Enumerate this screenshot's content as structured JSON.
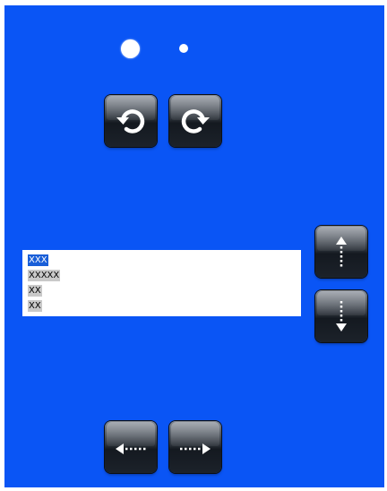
{
  "page_indicator": {
    "total": 2,
    "active_index": 0
  },
  "toolbar_top": {
    "rotate_left_icon": "rotate-counterclockwise-icon",
    "rotate_right_icon": "rotate-clockwise-icon"
  },
  "list": {
    "items": [
      {
        "label": "XXX",
        "selected": true
      },
      {
        "label": "XXXXX",
        "selected": false
      },
      {
        "label": "XX",
        "selected": false
      },
      {
        "label": "XX",
        "selected": false
      }
    ]
  },
  "side_controls": {
    "up_icon": "arrow-up-dotted-icon",
    "down_icon": "arrow-down-dotted-icon"
  },
  "toolbar_bottom": {
    "left_icon": "arrow-left-dotted-icon",
    "right_icon": "arrow-right-dotted-icon"
  },
  "colors": {
    "background": "#0a55f5",
    "button": "#1c222a",
    "list_background": "#ffffff",
    "selection": "#1a5fd8",
    "item_highlight": "#c9c9c9"
  }
}
